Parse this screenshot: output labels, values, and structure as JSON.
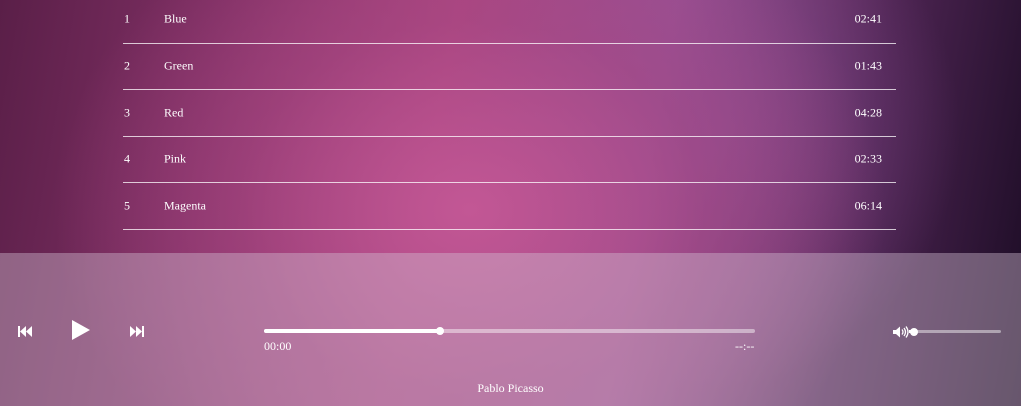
{
  "playlist": {
    "tracks": [
      {
        "number": "1",
        "title": "Blue",
        "duration": "02:41"
      },
      {
        "number": "2",
        "title": "Green",
        "duration": "01:43"
      },
      {
        "number": "3",
        "title": "Red",
        "duration": "04:28"
      },
      {
        "number": "4",
        "title": "Pink",
        "duration": "02:33"
      },
      {
        "number": "5",
        "title": "Magenta",
        "duration": "06:14"
      }
    ]
  },
  "player": {
    "controls": {
      "previous_icon": "skip-previous-icon",
      "play_icon": "play-icon",
      "next_icon": "skip-next-icon",
      "volume_icon": "volume-icon"
    },
    "current_time": "00:00",
    "total_time": "--:--",
    "progress_fraction": 0.358,
    "volume_fraction": 0.03,
    "artist": "Pablo Picasso"
  }
}
